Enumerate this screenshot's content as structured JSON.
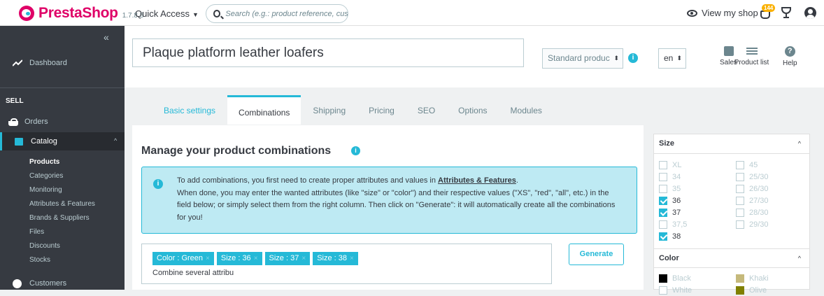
{
  "topbar": {
    "brand": "PrestaShop",
    "version": "1.7.8.8",
    "quick_access": "Quick Access",
    "search_placeholder": "Search (e.g.: product reference, custon",
    "view_shop": "View my shop",
    "notifications_count": "144"
  },
  "sidebar": {
    "dashboard": "Dashboard",
    "section": "SELL",
    "orders": "Orders",
    "catalog": "Catalog",
    "catalog_items": [
      "Products",
      "Categories",
      "Monitoring",
      "Attributes & Features",
      "Brands & Suppliers",
      "Files",
      "Discounts",
      "Stocks"
    ],
    "active_item": "Products",
    "customers": "Customers"
  },
  "header": {
    "product_name": "Plaque platform leather loafers",
    "product_type": "Standard produc",
    "language": "en",
    "tools": [
      "Sales",
      "Product list",
      "Help"
    ]
  },
  "tabs": [
    "Basic settings",
    "Combinations",
    "Shipping",
    "Pricing",
    "SEO",
    "Options",
    "Modules"
  ],
  "active_tab": "Combinations",
  "combinations": {
    "title": "Manage your product combinations",
    "alert_line1_pre": "To add combinations, you first need to create proper attributes and values in ",
    "alert_link": "Attributes & Features",
    "alert_line1_post": ".",
    "alert_rest": "When done, you may enter the wanted attributes (like \"size\" or \"color\") and their respective values (\"XS\", \"red\", \"all\", etc.) in the field below; or simply select them from the right column. Then click on \"Generate\": it will automatically create all the combinations for you!",
    "tags": [
      "Color : Green",
      "Size : 36",
      "Size : 37",
      "Size : 38"
    ],
    "input_placeholder": "Combine several attribu",
    "generate_button": "Generate"
  },
  "attributes": {
    "size_title": "Size",
    "size_left": [
      {
        "label": "XL",
        "checked": false
      },
      {
        "label": "34",
        "checked": false
      },
      {
        "label": "35",
        "checked": false
      },
      {
        "label": "36",
        "checked": true
      },
      {
        "label": "37",
        "checked": true
      },
      {
        "label": "37,5",
        "checked": false
      },
      {
        "label": "38",
        "checked": true
      }
    ],
    "size_right": [
      {
        "label": "45",
        "checked": false
      },
      {
        "label": "25/30",
        "checked": false
      },
      {
        "label": "26/30",
        "checked": false
      },
      {
        "label": "27/30",
        "checked": false
      },
      {
        "label": "28/30",
        "checked": false
      },
      {
        "label": "29/30",
        "checked": false
      }
    ],
    "color_title": "Color",
    "colors": [
      {
        "label": "Black",
        "swatch": "#000000"
      },
      {
        "label": "Khaki",
        "swatch": "#c5b97b"
      },
      {
        "label": "White",
        "swatch": "#ffffff"
      },
      {
        "label": "Olive",
        "swatch": "#808000"
      }
    ]
  },
  "colors": {
    "accent": "#25b9d7",
    "brand": "#df0067",
    "sidebar": "#363a41"
  }
}
